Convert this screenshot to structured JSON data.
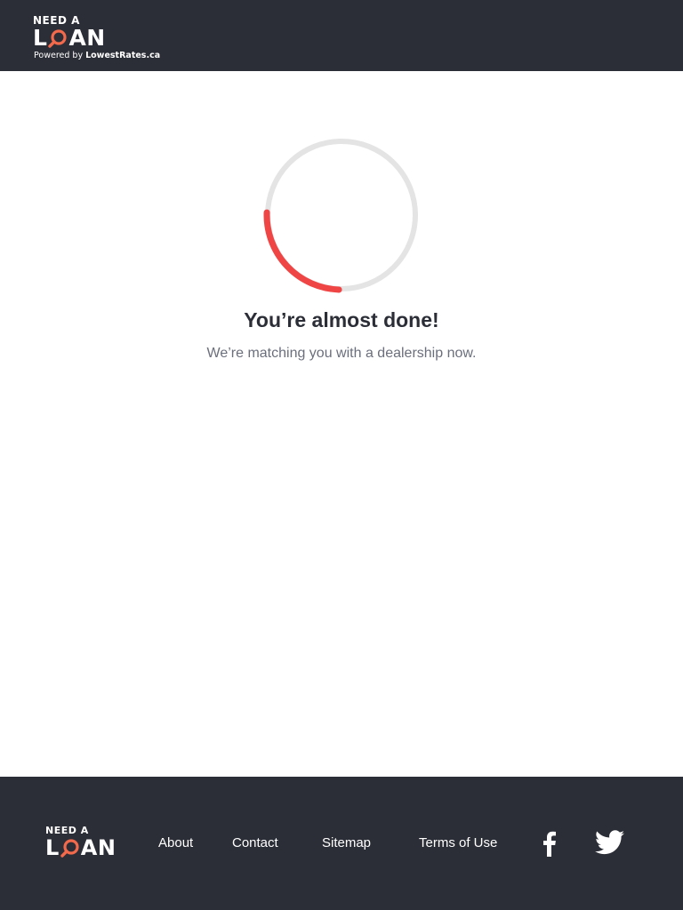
{
  "header": {
    "logo": {
      "line1": "NEED A",
      "line2_start": "L",
      "line2_end": "AN"
    },
    "powered_prefix": "Powered by",
    "powered_brand": "LowestRates.ca"
  },
  "main": {
    "progress": 0.25,
    "title": "You’re almost done!",
    "subtitle": "We’re matching you with a dealership now."
  },
  "footer": {
    "logo": {
      "line1": "NEED A",
      "line2_start": "L",
      "line2_end": "AN"
    },
    "links": [
      "About",
      "Contact",
      "Sitemap",
      "Terms of Use"
    ],
    "social": [
      "facebook-icon",
      "twitter-icon"
    ]
  },
  "colors": {
    "dark": "#2c2e37",
    "accent": "#f04545",
    "track": "#e4e4e4",
    "muted": "#6b6f7c"
  }
}
